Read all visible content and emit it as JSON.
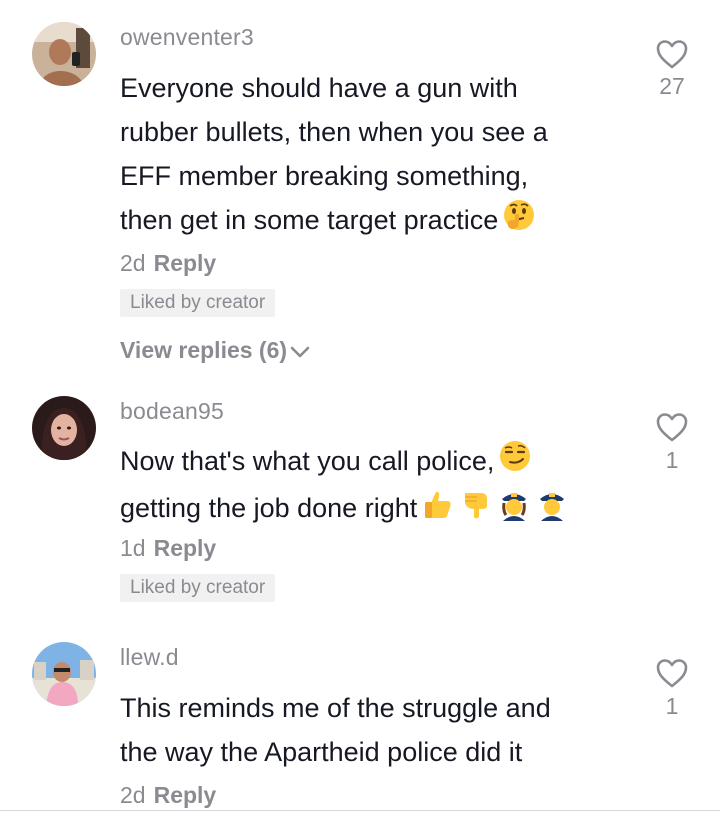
{
  "comments": [
    {
      "username": "owenventer3",
      "lines": [
        "Everyone should have a gun with",
        "rubber bullets, then when you see a",
        "EFF member breaking something,",
        "then get in some target practice"
      ],
      "emojis": [
        "thinking-face-emoji"
      ],
      "age": "2d",
      "reply_label": "Reply",
      "liked_by_creator": "Liked by creator",
      "view_replies": "View replies (6)",
      "like_count": "27"
    },
    {
      "username": "bodean95",
      "lines": [
        "Now that's what you call police,",
        "getting the job done right"
      ],
      "emojis": [
        "smirking-face-emoji",
        "thumbs-up-emoji",
        "backhand-pointing-down-emoji",
        "police-officer-woman-emoji",
        "police-officer-man-emoji"
      ],
      "age": "1d",
      "reply_label": "Reply",
      "liked_by_creator": "Liked by creator",
      "like_count": "1"
    },
    {
      "username": "llew.d",
      "lines": [
        "This reminds me of the struggle and",
        "the way the Apartheid police did it"
      ],
      "age": "2d",
      "reply_label": "Reply",
      "like_count": "1"
    }
  ],
  "colors": {
    "text_primary": "#161823",
    "text_secondary": "#8a8b91",
    "badge_bg": "#f1f1f2"
  }
}
